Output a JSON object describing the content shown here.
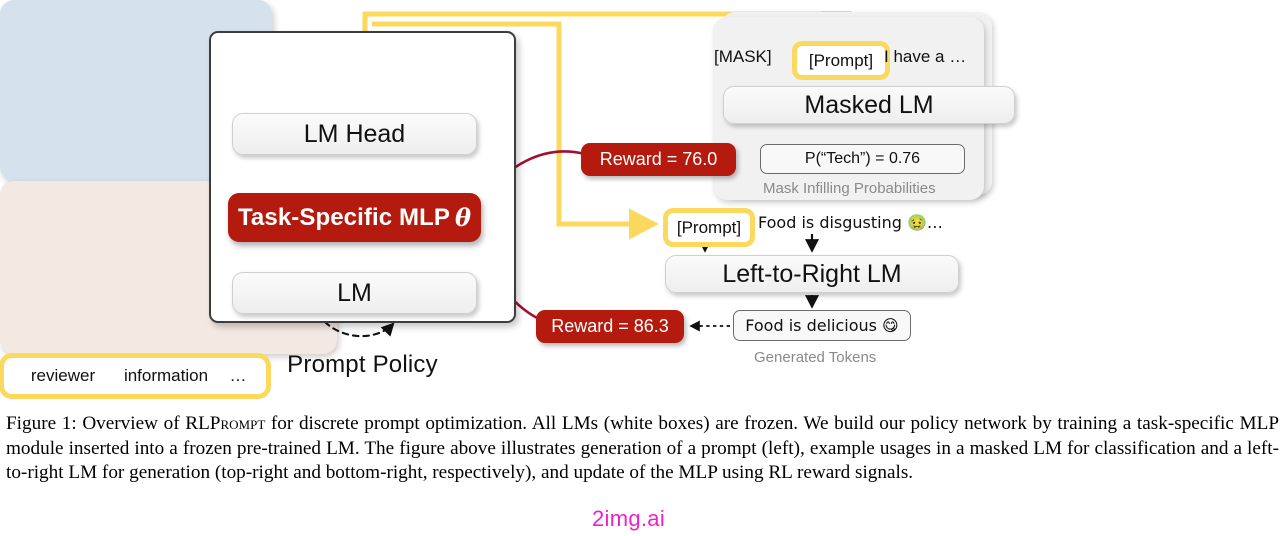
{
  "figure": {
    "policy": {
      "caption": "Prompt Policy",
      "tokens": {
        "first": "reviewer",
        "second": "information",
        "ellipsis": "…"
      },
      "lm_head": "LM Head",
      "mlp": "Task-Specific MLP",
      "mlp_param": "θ",
      "lm": "LM"
    },
    "masked_panel": {
      "mask_token": "[MASK]",
      "prompt_token": "[Prompt]",
      "context_token": "I have a …",
      "model": "Masked LM",
      "output": "P(“Tech”) = 0.76",
      "caption": "Mask Infilling Probabilities"
    },
    "generation_panel": {
      "prompt_token": "[Prompt]",
      "context_token": "Food is disgusting 🤢…",
      "model": "Left-to-Right LM",
      "output": "Food is delicious 😋",
      "caption": "Generated Tokens"
    },
    "rewards": {
      "masked": "Reward = 76.0",
      "generation": "Reward = 86.3"
    },
    "colors": {
      "mlp_red": "#b41b0e",
      "reward_red": "#b41b0e",
      "prompt_highlight": "#fbd95e",
      "masked_panel_bg": "#d5e2ee",
      "generation_panel_bg": "#f4e8e2",
      "arrow_gray": "#555555",
      "reward_arrow": "#a01030",
      "watermark_pink": "#ee22c4"
    }
  },
  "caption": {
    "label": "Figure 1:",
    "text_1": " Overview of ",
    "method_name_r": "RL",
    "method_name_prompt": "Prompt",
    "text_2": " for discrete prompt optimization. All LMs (white boxes) are frozen. We build our policy network by training a task-specific MLP module inserted into a frozen pre-trained LM. The figure above illustrates generation of a prompt (left), example usages in a masked LM for classification and a left-to-right LM for generation (top-right and bottom-right, respectively), and update of the MLP using RL reward signals."
  },
  "watermark": {
    "text": "2img.ai"
  }
}
